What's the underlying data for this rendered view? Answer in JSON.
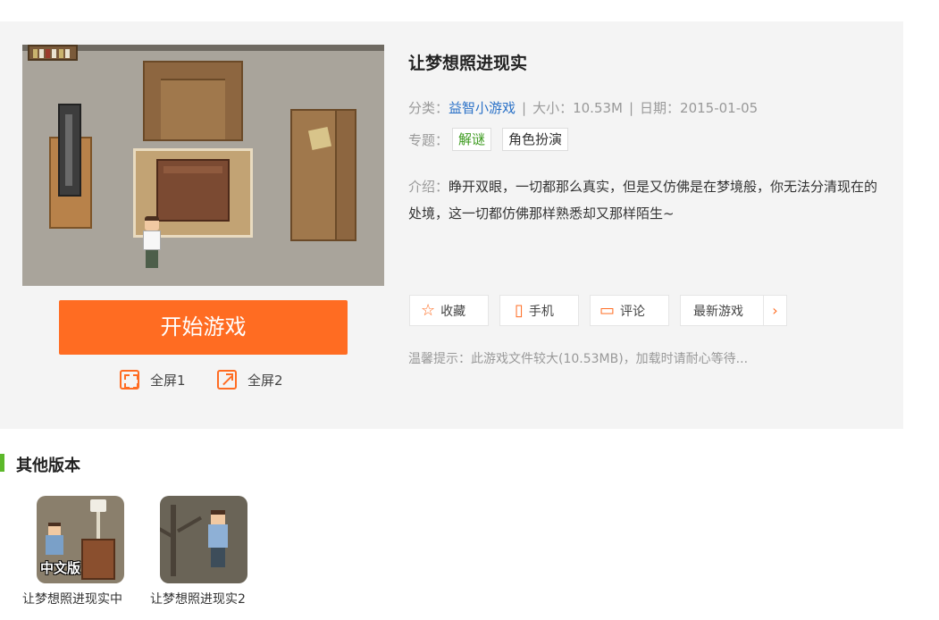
{
  "game": {
    "title": "让梦想照进现实",
    "category_label": "分类：",
    "category_value": "益智小游戏",
    "separator": "|",
    "size_text": "大小：10.53M",
    "date_text": "日期：2015-01-05",
    "topic_label": "专题：",
    "topics": [
      "解谜",
      "角色扮演"
    ],
    "intro_label": "介绍：",
    "intro_text": "睁开双眼，一切都那么真实，但是又仿佛是在梦境般，你无法分清现在的处境，这一切都仿佛那样熟悉却又那样陌生~"
  },
  "player": {
    "start_label": "开始游戏",
    "fullscreen1_label": "全屏1",
    "fullscreen2_label": "全屏2"
  },
  "actions": {
    "favorite_label": "收藏",
    "mobile_label": "手机",
    "comment_label": "评论",
    "newest_label": "最新游戏"
  },
  "tip": "温馨提示：此游戏文件较大(10.53MB)，加载时请耐心等待...",
  "other_versions": {
    "section_title": "其他版本",
    "items": [
      {
        "name": "让梦想照进现实中",
        "badge": "中文版"
      },
      {
        "name": "让梦想照进现实2"
      }
    ]
  },
  "colors": {
    "accent": "#ff6c22",
    "link": "#2a71c7",
    "tag_green": "#3c9a1e",
    "section_bar": "#5cb82a"
  },
  "icons": [
    "star-icon",
    "phone-icon",
    "comment-icon",
    "chevron-right-icon",
    "fullscreen-icon",
    "expand-icon"
  ]
}
